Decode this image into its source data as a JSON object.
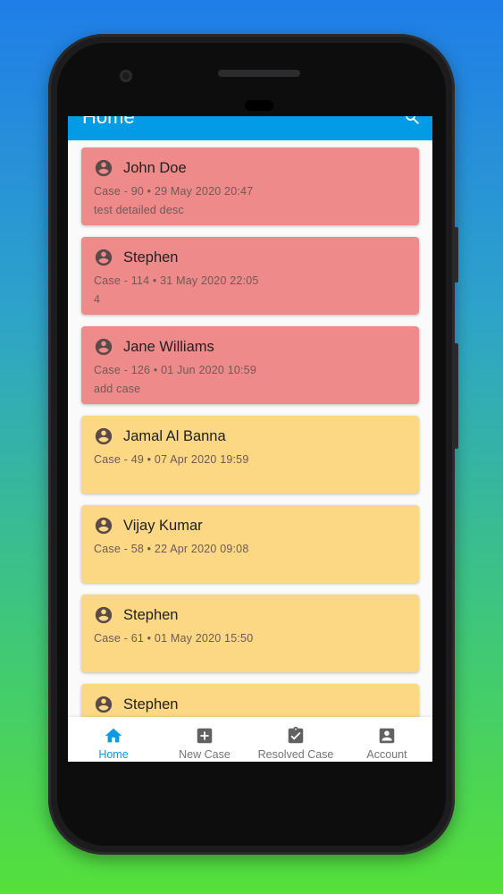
{
  "app": {
    "title": "Home"
  },
  "colors": {
    "appbar": "#039be5",
    "card_red": "#ef8a8a",
    "card_yellow": "#fcd784",
    "active": "#039be5",
    "inactive": "#616161"
  },
  "cases": [
    {
      "name": "John Doe",
      "meta": "Case - 90 • 29 May 2020 20:47",
      "desc": "test detailed desc",
      "status": "red"
    },
    {
      "name": "Stephen",
      "meta": "Case - 114 • 31 May 2020 22:05",
      "desc": "4",
      "status": "red"
    },
    {
      "name": "Jane Williams",
      "meta": "Case - 126 • 01 Jun 2020 10:59",
      "desc": "add case",
      "status": "red"
    },
    {
      "name": "Jamal Al Banna",
      "meta": "Case - 49 • 07 Apr 2020 19:59",
      "desc": "",
      "status": "yellow"
    },
    {
      "name": "Vijay Kumar",
      "meta": "Case - 58 • 22 Apr 2020 09:08",
      "desc": "",
      "status": "yellow"
    },
    {
      "name": "Stephen",
      "meta": "Case - 61 • 01 May 2020 15:50",
      "desc": "",
      "status": "yellow"
    },
    {
      "name": "Stephen",
      "meta": "",
      "desc": "",
      "status": "yellow"
    }
  ],
  "bottom_nav": {
    "items": [
      {
        "label": "Home",
        "icon": "home-icon",
        "active": true
      },
      {
        "label": "New Case",
        "icon": "add-box-icon",
        "active": false
      },
      {
        "label": "Resolved Case",
        "icon": "assignment-turned-in-icon",
        "active": false
      },
      {
        "label": "Account",
        "icon": "account-box-icon",
        "active": false
      }
    ]
  }
}
